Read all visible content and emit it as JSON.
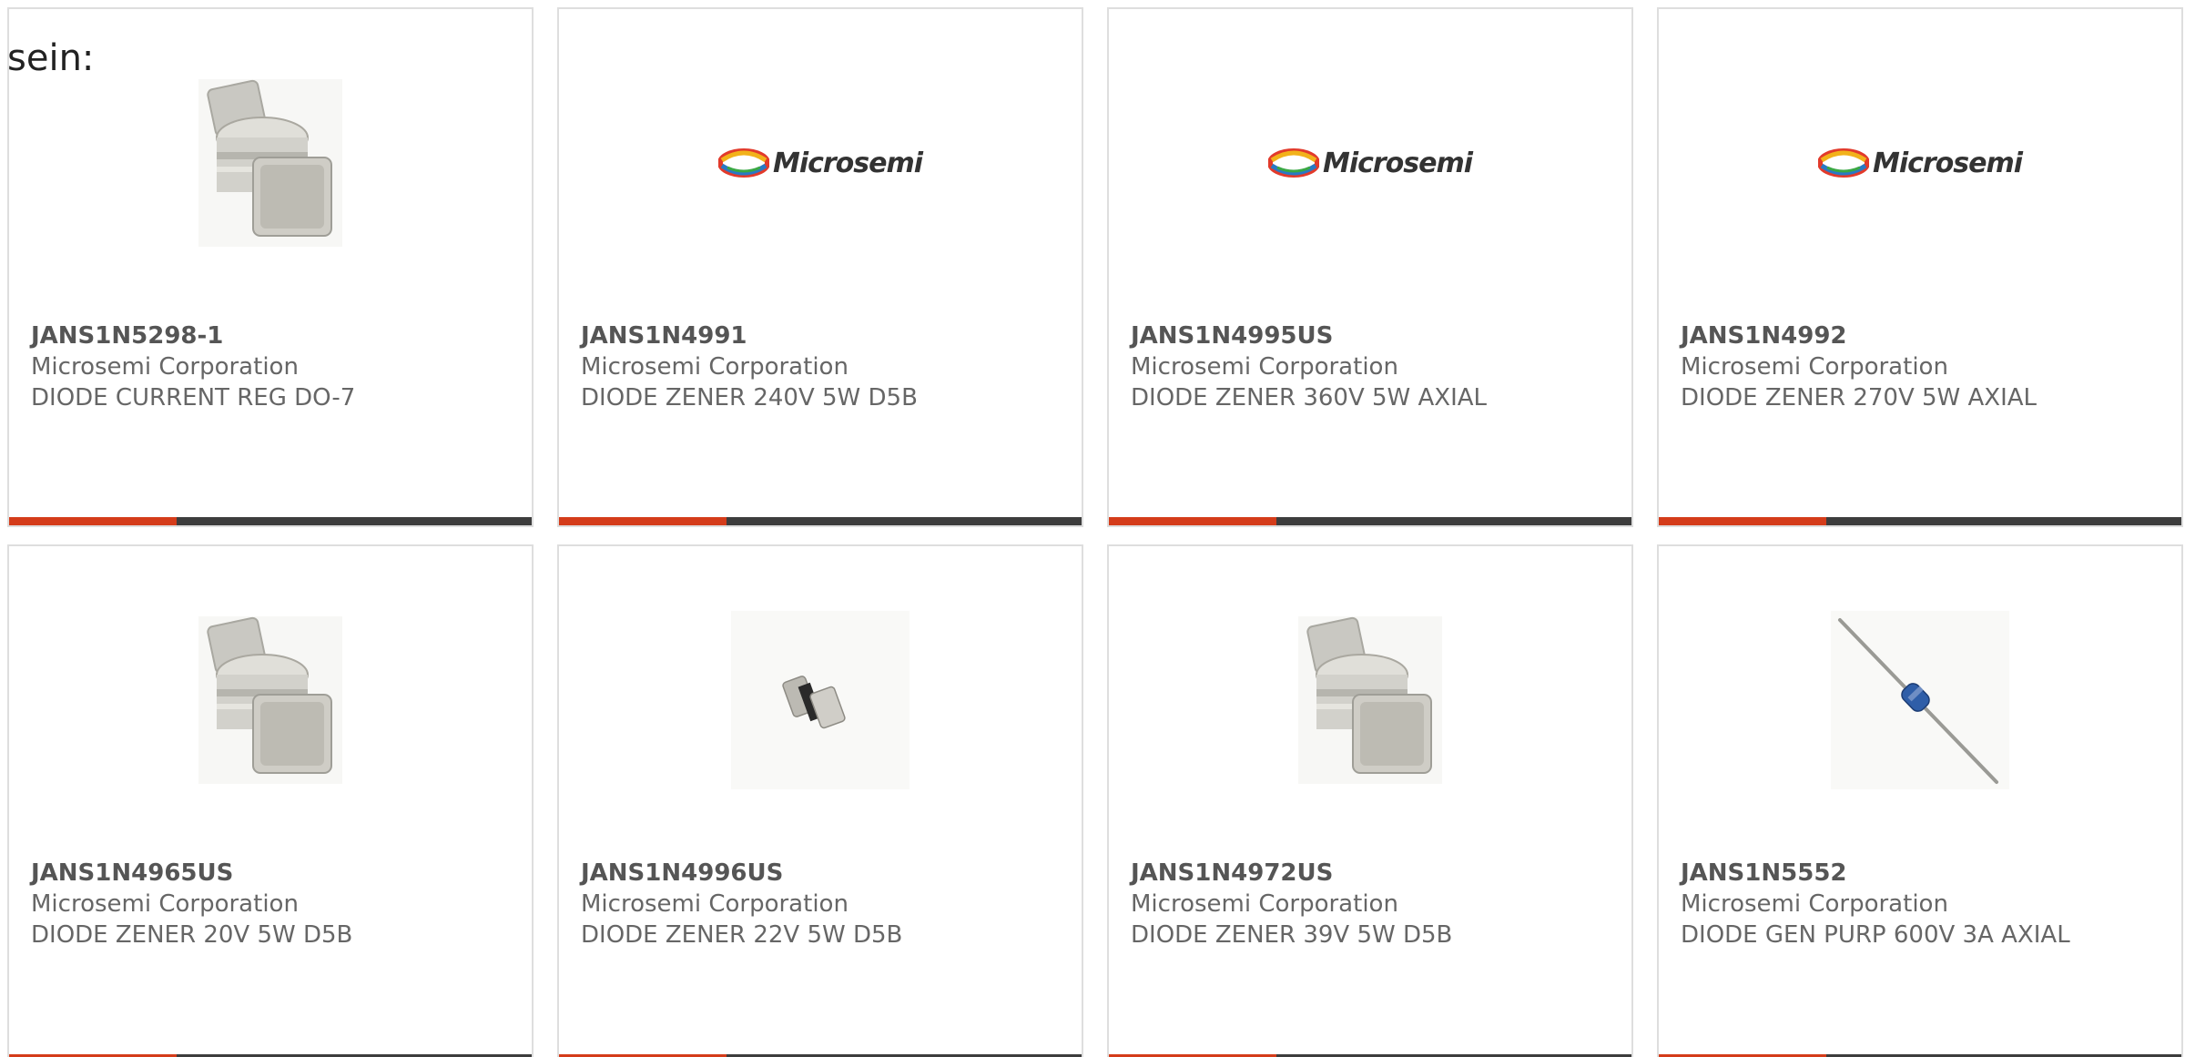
{
  "intro_text": "sein:",
  "colors": {
    "accent": "#d43c1a",
    "bar": "#3d3d3d",
    "border": "#dedede",
    "text": "#666666"
  },
  "products": [
    {
      "part_number": "JANS1N5298-1",
      "manufacturer": "Microsemi Corporation",
      "description": "DIODE CURRENT REG DO-7",
      "image": "metal-can-diode-icon"
    },
    {
      "part_number": "JANS1N4991",
      "manufacturer": "Microsemi Corporation",
      "description": "DIODE ZENER 240V 5W D5B",
      "image": "microsemi-logo",
      "logo_text": "Microsemi"
    },
    {
      "part_number": "JANS1N4995US",
      "manufacturer": "Microsemi Corporation",
      "description": "DIODE ZENER 360V 5W AXIAL",
      "image": "microsemi-logo",
      "logo_text": "Microsemi"
    },
    {
      "part_number": "JANS1N4992",
      "manufacturer": "Microsemi Corporation",
      "description": "DIODE ZENER 270V 5W AXIAL",
      "image": "microsemi-logo",
      "logo_text": "Microsemi"
    },
    {
      "part_number": "JANS1N4965US",
      "manufacturer": "Microsemi Corporation",
      "description": "DIODE ZENER 20V 5W D5B",
      "image": "metal-can-diode-icon"
    },
    {
      "part_number": "JANS1N4996US",
      "manufacturer": "Microsemi Corporation",
      "description": "DIODE ZENER 22V 5W D5B",
      "image": "small-smd-diode-icon"
    },
    {
      "part_number": "JANS1N4972US",
      "manufacturer": "Microsemi Corporation",
      "description": "DIODE ZENER 39V 5W D5B",
      "image": "metal-can-diode-icon"
    },
    {
      "part_number": "JANS1N5552",
      "manufacturer": "Microsemi Corporation",
      "description": "DIODE GEN PURP 600V 3A AXIAL",
      "image": "axial-lead-diode-icon"
    }
  ]
}
